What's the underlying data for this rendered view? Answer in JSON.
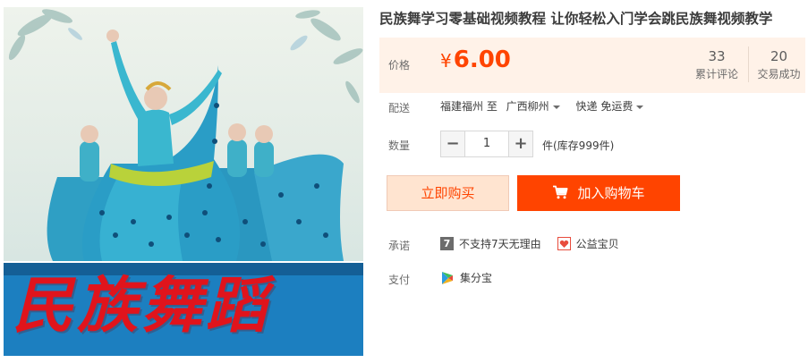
{
  "product": {
    "title": "民族舞学习零基础视频教程 让你轻松入门学会跳民族舞视频教学",
    "banner_text": "民族舞蹈",
    "image_icon": "peacock-dance-photo"
  },
  "price": {
    "label": "价格",
    "currency": "¥",
    "amount": "6.00",
    "color": "#ff4400",
    "box_color": "#fff2e8"
  },
  "stats": {
    "reviews_count": "33",
    "reviews_label": "累计评论",
    "deals_count": "20",
    "deals_label": "交易成功"
  },
  "delivery": {
    "label": "配送",
    "from": "福建福州 至",
    "to": "广西柳州",
    "method": "快递 免运费"
  },
  "quantity": {
    "label": "数量",
    "minus_icon": "minus-icon",
    "plus_icon": "plus-icon",
    "minus": "−",
    "plus": "+",
    "value": "1",
    "stock": "件(库存999件)"
  },
  "actions": {
    "buy_now": "立即购买",
    "add_to_cart": "加入购物车",
    "cart_icon": "cart-icon",
    "buy_now_color": "#ffe4d0",
    "add_to_cart_color": "#ff4400"
  },
  "promise": {
    "label": "承诺",
    "no_return_badge": "7",
    "no_return": "不支持7天无理由",
    "charity_icon": "heart-icon",
    "charity": "公益宝贝"
  },
  "payment": {
    "label": "支付",
    "method_icon": "jifenbao-icon",
    "method": "集分宝"
  }
}
